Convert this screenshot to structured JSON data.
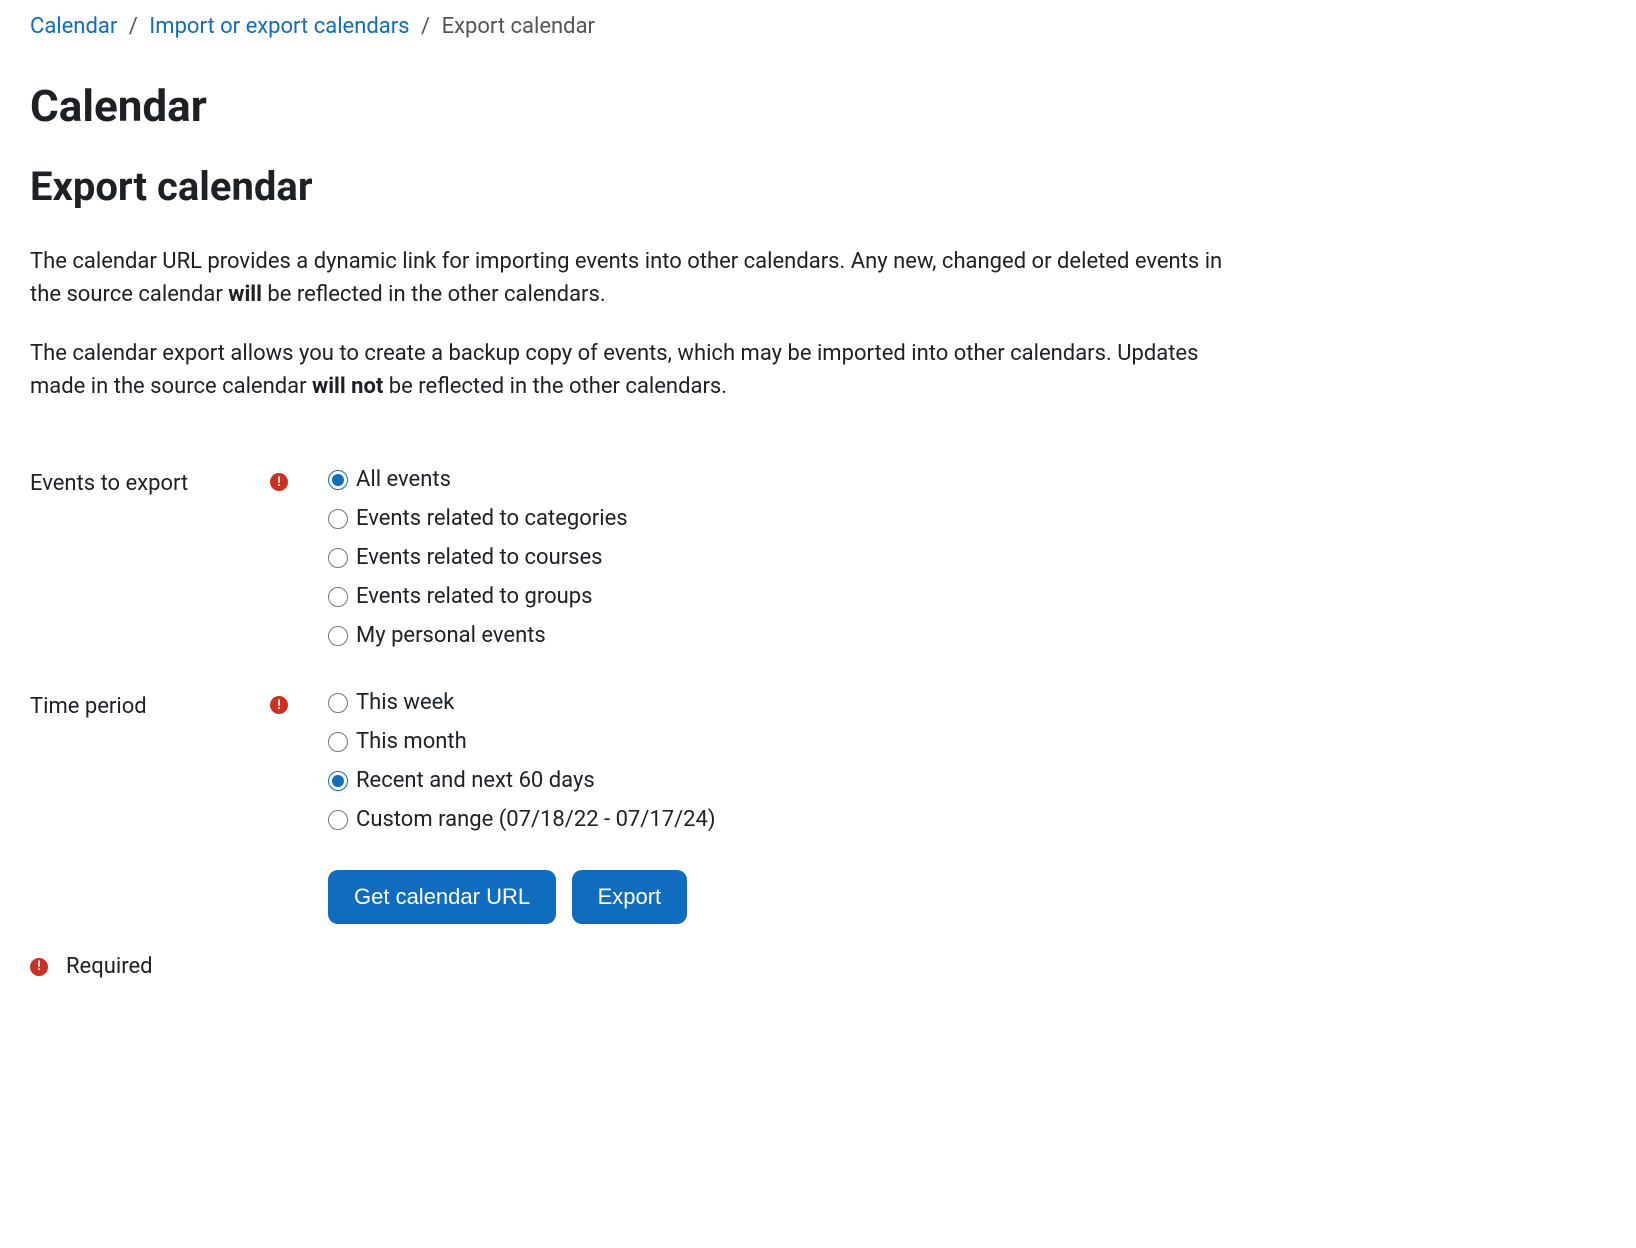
{
  "breadcrumb": {
    "items": [
      {
        "label": "Calendar",
        "link": true
      },
      {
        "label": "Import or export calendars",
        "link": true
      },
      {
        "label": "Export calendar",
        "link": false
      }
    ]
  },
  "page_title": "Calendar",
  "sub_title": "Export calendar",
  "intro_p1_a": "The calendar URL provides a dynamic link for importing events into other calendars. Any new, changed or deleted events in the source calendar ",
  "intro_p1_strong": "will",
  "intro_p1_b": " be reflected in the other calendars.",
  "intro_p2_a": "The calendar export allows you to create a backup copy of events, which may be imported into other calendars. Updates made in the source calendar ",
  "intro_p2_strong": "will not",
  "intro_p2_b": " be reflected in the other calendars.",
  "form": {
    "events": {
      "label": "Events to export",
      "options": [
        "All events",
        "Events related to categories",
        "Events related to courses",
        "Events related to groups",
        "My personal events"
      ],
      "selected": 0
    },
    "period": {
      "label": "Time period",
      "options": [
        "This week",
        "This month",
        "Recent and next 60 days",
        "Custom range (07/18/22 - 07/17/24)"
      ],
      "selected": 2
    },
    "buttons": {
      "get_url": "Get calendar URL",
      "export": "Export"
    }
  },
  "required_icon_glyph": "!",
  "required_legend": "Required"
}
